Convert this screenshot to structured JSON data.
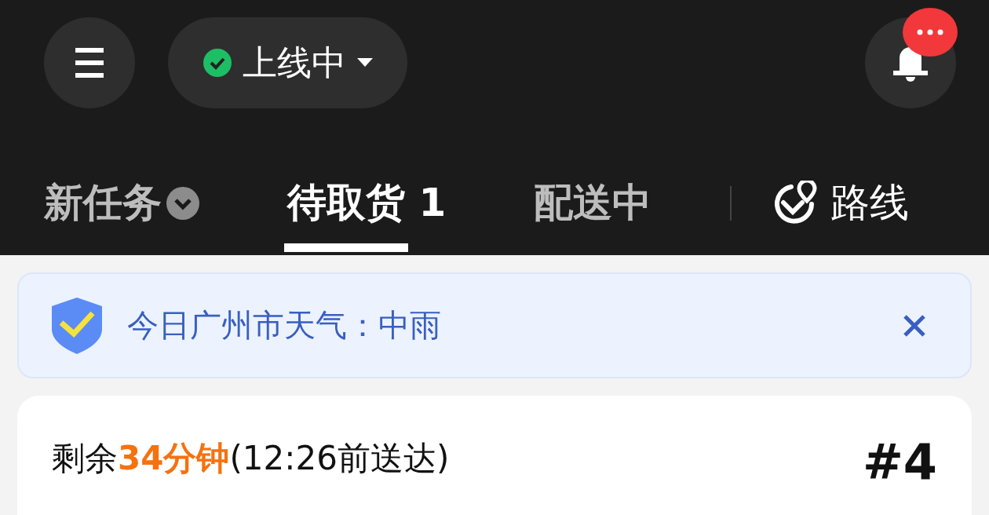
{
  "status": {
    "label": "上线中",
    "online": true
  },
  "tabs": [
    {
      "label": "新任务",
      "kind": "dropdown",
      "selected": false
    },
    {
      "label": "待取货 1",
      "kind": "plain",
      "selected": true
    },
    {
      "label": "配送中",
      "kind": "plain",
      "selected": false
    },
    {
      "label": "路线",
      "kind": "route",
      "selected": false
    }
  ],
  "banner": {
    "text": "今日广州市天气：中雨"
  },
  "order": {
    "time_info": "剩余**34分钟**(12:26前送达)",
    "number": "#4"
  }
}
